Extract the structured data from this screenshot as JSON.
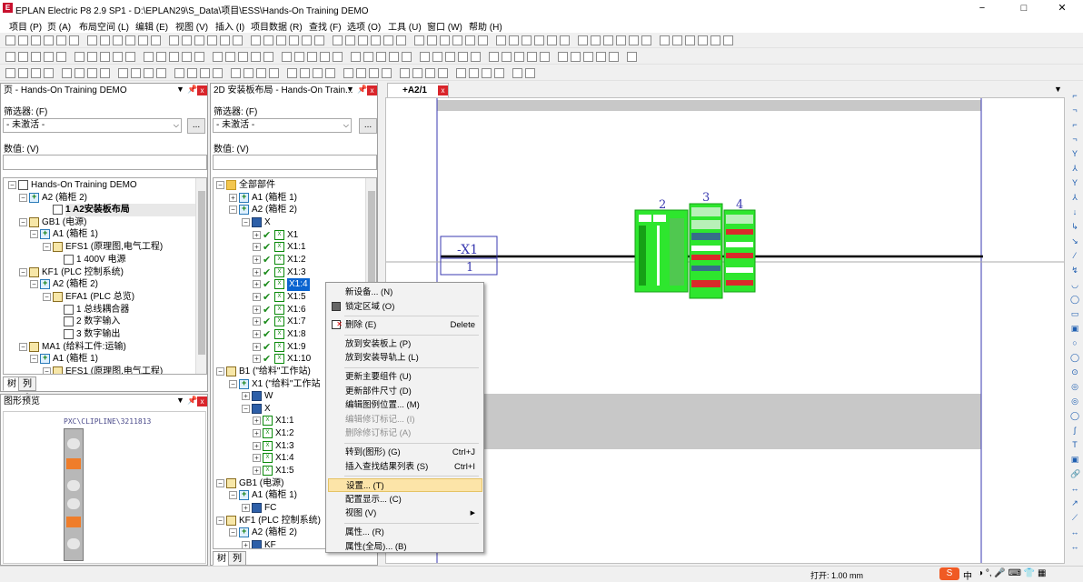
{
  "window": {
    "title": "EPLAN Electric P8 2.9 SP1 - D:\\EPLAN29\\S_Data\\项目\\ESS\\Hands-On Training DEMO",
    "minimize": "−",
    "maximize": "□",
    "close": "✕"
  },
  "menu": [
    "项目 (P)",
    "页 (A)",
    "布局空间 (L)",
    "编辑 (E)",
    "视图 (V)",
    "插入 (I)",
    "项目数据 (R)",
    "查找 (F)",
    "选项 (O)",
    "工具 (U)",
    "窗口 (W)",
    "帮助 (H)"
  ],
  "page_panel": {
    "title": "页 - Hands-On Training DEMO",
    "filter_label": "筛选器: (F)",
    "filter_value": "- 未激活 -",
    "dots": "...",
    "value_label": "数值: (V)",
    "tree": [
      {
        "label": "Hands-On Training DEMO",
        "bold": false
      },
      {
        "label": "A2 (箱柜 2)"
      },
      {
        "label": "1 A2安装板布局",
        "bold": true
      },
      {
        "label": "GB1 (电源)"
      },
      {
        "label": "A1 (箱柜 1)"
      },
      {
        "label": "EFS1 (原理图,电气工程)"
      },
      {
        "label": "1 400V 电源"
      },
      {
        "label": "KF1 (PLC 控制系统)"
      },
      {
        "label": "A2 (箱柜 2)"
      },
      {
        "label": "EFA1 (PLC 总览)"
      },
      {
        "label": "1 总线耦合器"
      },
      {
        "label": "2 数字输入"
      },
      {
        "label": "3 数字输出"
      },
      {
        "label": "MA1 (给料工件:运输)"
      },
      {
        "label": "A1 (箱柜 1)"
      },
      {
        "label": "EFS1 (原理图,电气工程)"
      }
    ],
    "tabs": [
      "树",
      "列表"
    ]
  },
  "preview_panel": {
    "title": "图形预览",
    "part_label": "PXC\\CLIPLINE\\3211813"
  },
  "layout_panel": {
    "title": "2D 安装板布局 - Hands-On Train...",
    "filter_label": "筛选器: (F)",
    "filter_value": "- 未激活 -",
    "dots": "...",
    "value_label": "数值: (V)",
    "tree": [
      {
        "label": "全部部件"
      },
      {
        "label": "A1 (箱柜 1)"
      },
      {
        "label": "A2 (箱柜 2)"
      },
      {
        "label": "X"
      },
      {
        "label": "X1"
      },
      {
        "label": "X1:1"
      },
      {
        "label": "X1:2"
      },
      {
        "label": "X1:3"
      },
      {
        "label": "X1:4",
        "selected": true
      },
      {
        "label": "X1:5"
      },
      {
        "label": "X1:6"
      },
      {
        "label": "X1:7"
      },
      {
        "label": "X1:8"
      },
      {
        "label": "X1:9"
      },
      {
        "label": "X1:10"
      },
      {
        "label": "B1 (\"给料\"工作站)"
      },
      {
        "label": "X1 (\"给料\"工作站"
      },
      {
        "label": "W"
      },
      {
        "label": "X"
      },
      {
        "label": "X1:1"
      },
      {
        "label": "X1:2"
      },
      {
        "label": "X1:3"
      },
      {
        "label": "X1:4"
      },
      {
        "label": "X1:5"
      },
      {
        "label": "GB1 (电源)"
      },
      {
        "label": "A1 (箱柜 1)"
      },
      {
        "label": "FC"
      },
      {
        "label": "KF1 (PLC 控制系统)"
      },
      {
        "label": "A2 (箱柜 2)"
      },
      {
        "label": "KF"
      }
    ],
    "tabs": [
      "树",
      "列表"
    ]
  },
  "context_menu": [
    {
      "label": "新设备... (N)"
    },
    {
      "label": "锁定区域 (O)",
      "icon": "lock-area-icon"
    },
    {
      "sep": true
    },
    {
      "label": "删除 (E)",
      "shortcut": "Delete",
      "icon": "delete-icon"
    },
    {
      "sep": true
    },
    {
      "label": "放到安装板上 (P)"
    },
    {
      "label": "放到安装导轨上 (L)"
    },
    {
      "sep": true
    },
    {
      "label": "更新主要组件 (U)"
    },
    {
      "label": "更新部件尺寸 (D)"
    },
    {
      "label": "编辑图例位置... (M)"
    },
    {
      "label": "编辑修订标记... (I)",
      "disabled": true
    },
    {
      "label": "删除修订标记 (A)",
      "disabled": true
    },
    {
      "sep": true
    },
    {
      "label": "转到(图形) (G)",
      "shortcut": "Ctrl+J"
    },
    {
      "label": "插入查找结果列表 (S)",
      "shortcut": "Ctrl+I"
    },
    {
      "sep": true
    },
    {
      "label": "设置... (T)",
      "highlight": true
    },
    {
      "label": "配置显示... (C)"
    },
    {
      "label": "视图 (V)",
      "submenu": true
    },
    {
      "sep": true
    },
    {
      "label": "属性... (R)"
    },
    {
      "label": "属性(全局)... (B)"
    }
  ],
  "document": {
    "tab": "+A2/1",
    "rail_tag": "-X1",
    "rail_num": "1",
    "labels": [
      "2",
      "3",
      "4"
    ],
    "colors": {
      "green": "#2ee62e",
      "green_dark": "#16a016",
      "rail": "#000000",
      "frame": "#3a3ab0",
      "gray": "#c8c8c8"
    }
  },
  "status": {
    "zoom": "打开: 1.00 mm",
    "ime": "中"
  }
}
